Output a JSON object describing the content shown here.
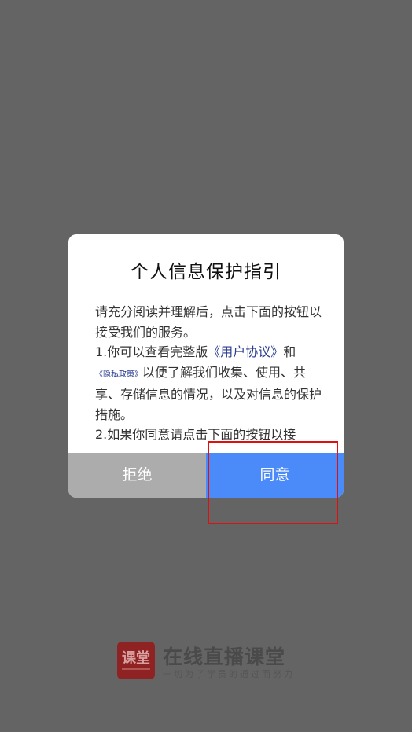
{
  "dialog": {
    "title": "个人信息保护指引",
    "para1": "请充分阅读并理解后，点击下面的按钮以接受我们的服务。",
    "para2_prefix": "1.你可以查看完整版",
    "link_user_agreement": "《用户协议》",
    "para2_and": "和",
    "link_privacy_policy": "《隐私政策》",
    "para2_suffix": "以便了解我们收集、使用、共享、存储信息的情况，以及对信息的保护措施。",
    "para3": "2.如果你同意请点击下面的按钮以接",
    "reject_label": "拒绝",
    "agree_label": "同意"
  },
  "brand": {
    "logo_text": "课堂",
    "name": "在线直播课堂",
    "slogan": "一切为了学员的通过而努力"
  },
  "colors": {
    "overlay": "#646464",
    "reject_button": "#acacac",
    "agree_button": "#4b8af9",
    "link": "#2a3d8f",
    "highlight": "#e01010"
  }
}
